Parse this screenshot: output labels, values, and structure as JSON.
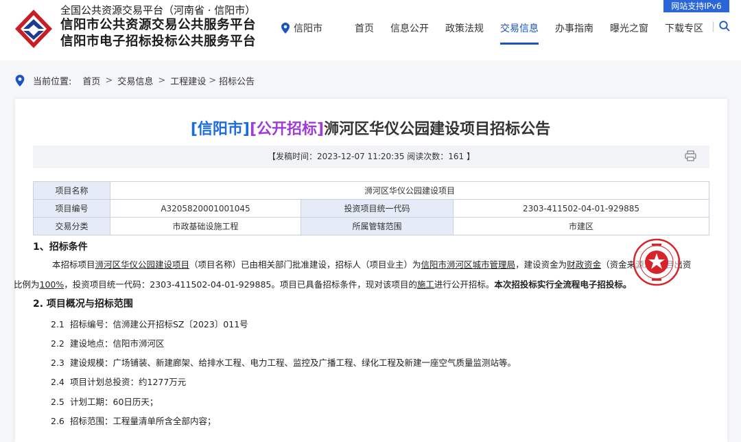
{
  "header": {
    "org_line1": "全国公共资源交易平台（河南省 · 信阳市）",
    "org_line2": "信阳市公共资源交易公共服务平台",
    "org_line3": "信阳市电子招标投标公共服务平台",
    "location": "信阳市",
    "ipv6_badge": "网站支持IPv6",
    "nav": [
      {
        "label": "首页",
        "active": false
      },
      {
        "label": "信息公开",
        "active": false
      },
      {
        "label": "政策法规",
        "active": false
      },
      {
        "label": "交易信息",
        "active": true
      },
      {
        "label": "办事指南",
        "active": false
      },
      {
        "label": "曝光之窗",
        "active": false
      },
      {
        "label": "下载专区",
        "active": false
      }
    ],
    "accent": "#1a52c9"
  },
  "breadcrumb": {
    "prefix": "当前位置:",
    "items": [
      "首页",
      "交易信息",
      "工程建设",
      "招标公告"
    ],
    "sep": ">"
  },
  "article": {
    "title_part1": "[信阳市]",
    "title_part2": "[公开招标]",
    "title_part3": "浉河区华仪公园建设项目招标公告",
    "meta": "【发稿时间：2023-12-07 11:20:35   阅读次数：161 】",
    "table": {
      "r1": {
        "label": "项目名称",
        "value": "浉河区华仪公园建设项目"
      },
      "r2": {
        "label": "项目编号",
        "value": "A3205820001001045",
        "label2": "投资项目统一代码",
        "value2": "2303-411502-04-01-929885"
      },
      "r3": {
        "label": "交易分类",
        "value": "市政基础设施工程",
        "label2": "所属管辖范围",
        "value2": "市建区"
      }
    },
    "sec1_title": "1、招标条件",
    "sec1": {
      "t1": "本招标项目",
      "proj": "浉河区华仪公园建设项目",
      "t2": "（项目名称）已由相关部门批准建设，招标人（项目业主）为",
      "owner": "信阳市浉河区城市管理局",
      "t3": "，建设资金为",
      "fund": "财政资金",
      "t4": "（资金来源），项目出资",
      "t5": "比例为",
      "ratio": "100%",
      "t6": "，投资项目统一代码：2303-411502-04-01-929885。项目已具备招标条件，现对该项目的",
      "stage": "施工",
      "t7": "进行公开招标。",
      "bold": "本次招投标实行全流程电子招投标。"
    },
    "sec2_title": "2. 项目概况与招标范围",
    "items": [
      {
        "no": "2.1",
        "text": "招标编号：信浉建公开招标SZ〔2023〕011号"
      },
      {
        "no": "2.2",
        "text": "建设地点：信阳市浉河区"
      },
      {
        "no": "2.3",
        "text": "建设规模：广场铺装、新建廊架、给排水工程、电力工程、监控及广播工程、绿化工程及新建一座空气质量监测站等。"
      },
      {
        "no": "2.4",
        "text": "项目计划总投资：约1277万元"
      },
      {
        "no": "2.5",
        "text": "计划工期：60日历天；"
      },
      {
        "no": "2.6",
        "text": "招标范围：工程量清单所含全部内容；"
      }
    ]
  }
}
